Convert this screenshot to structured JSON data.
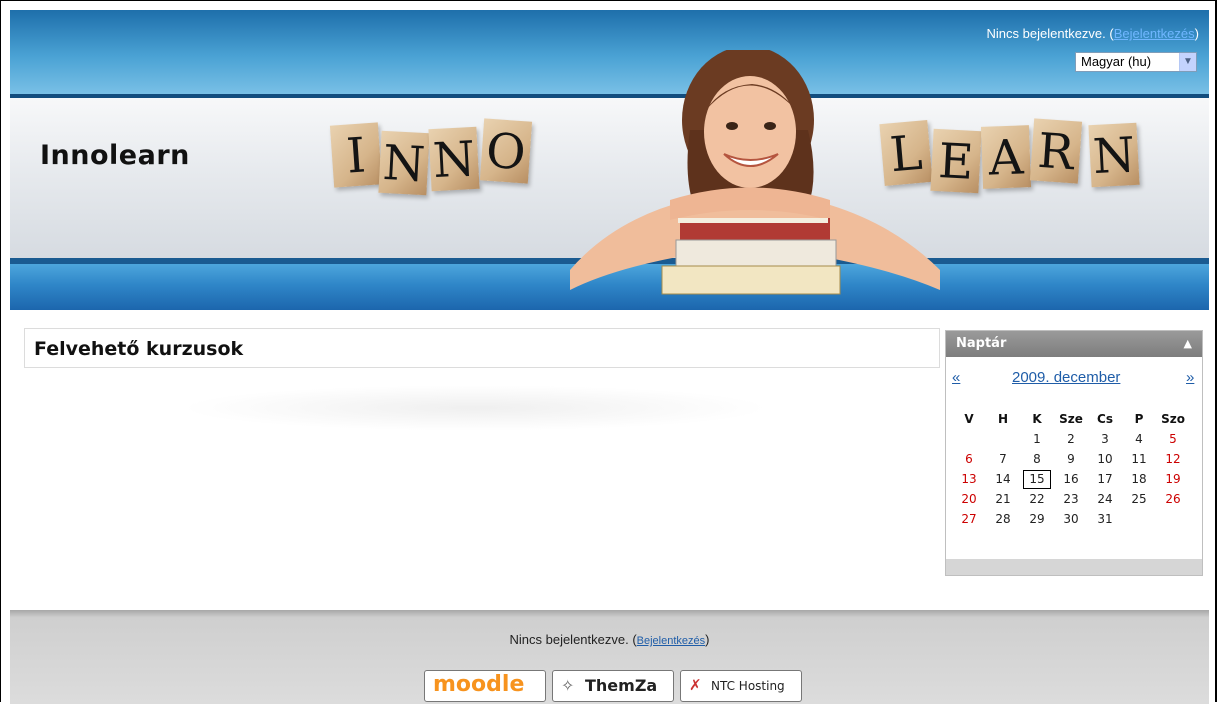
{
  "header": {
    "site_title": "Innolearn",
    "login_status_prefix": "Nincs bejelentkezve. (",
    "login_link": "Bejelentkezés",
    "login_status_suffix": ")",
    "language_selected": "Magyar (hu)",
    "blocks_left": [
      "I",
      "N",
      "N",
      "O"
    ],
    "blocks_right": [
      "L",
      "E",
      "A",
      "R",
      "N"
    ]
  },
  "main": {
    "section_title": "Felvehető kurzusok"
  },
  "calendar": {
    "title": "Naptár",
    "prev": "«",
    "month": "2009. december",
    "next": "»",
    "weekdays": [
      "V",
      "H",
      "K",
      "Sze",
      "Cs",
      "P",
      "Szo"
    ],
    "weeks": [
      [
        "",
        "",
        "1",
        "2",
        "3",
        "4",
        "5"
      ],
      [
        "6",
        "7",
        "8",
        "9",
        "10",
        "11",
        "12"
      ],
      [
        "13",
        "14",
        "15",
        "16",
        "17",
        "18",
        "19"
      ],
      [
        "20",
        "21",
        "22",
        "23",
        "24",
        "25",
        "26"
      ],
      [
        "27",
        "28",
        "29",
        "30",
        "31",
        "",
        ""
      ]
    ],
    "today": "15"
  },
  "footer": {
    "login_status_prefix": "Nincs bejelentkezve. (",
    "login_link": "Bejelentkezés",
    "login_status_suffix": ")",
    "badges": [
      "moodle",
      "ThemZa",
      "NTC Hosting"
    ]
  },
  "colors": {
    "header_blue": "#2f86c8",
    "weekend_red": "#cc0000",
    "link_blue": "#1f5da8"
  }
}
